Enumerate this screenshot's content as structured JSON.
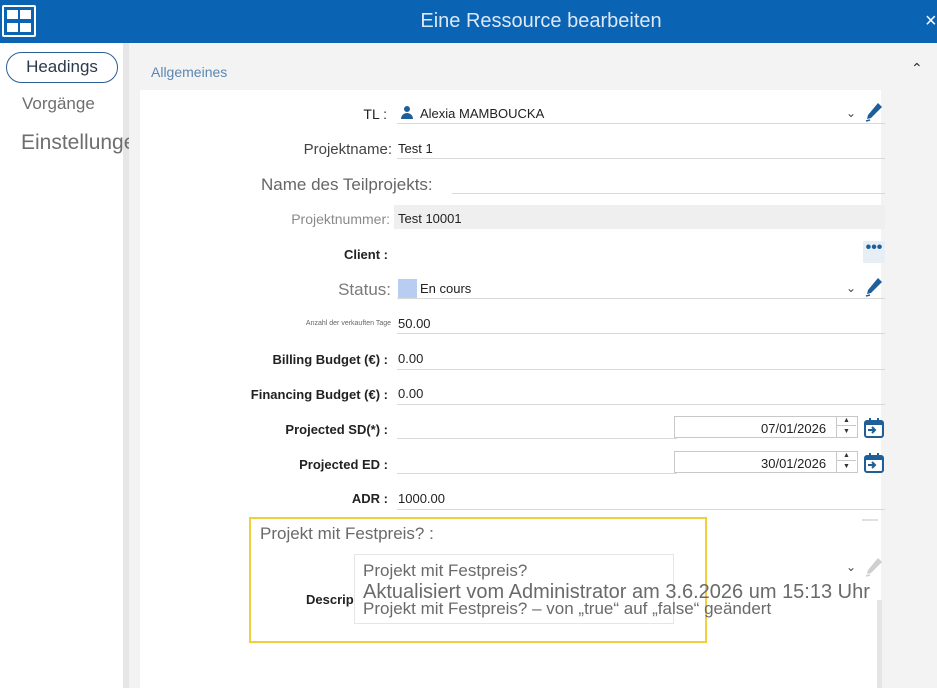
{
  "window": {
    "title": "Eine Ressource bearbeiten",
    "close_glyph": "×"
  },
  "nav": {
    "items": [
      {
        "label": "Headings",
        "active": true
      },
      {
        "label": "Vorgänge"
      },
      {
        "label": "Einstellungen"
      }
    ]
  },
  "section": {
    "title": "Allgemeines",
    "collapse_glyph": "⌃"
  },
  "form": {
    "tl": {
      "label": "TL :",
      "value": "Alexia MAMBOUCKA"
    },
    "projektname": {
      "label": "Projektname:",
      "value": "Test 1"
    },
    "teilprojekt": {
      "label": "Name des Teilprojekts:"
    },
    "projektnummer": {
      "label": "Projektnummer:",
      "value": "Test 10001"
    },
    "client": {
      "label": "Client :",
      "button": "•••"
    },
    "status": {
      "label": "Status:",
      "value": "En cours",
      "swatch_color": "#b9cdf3"
    },
    "verkaufte_tage": {
      "label": "Anzahl der verkauften Tage",
      "value": "50.00"
    },
    "billing_budget": {
      "label": "Billing Budget (€) :",
      "value": "0.00"
    },
    "financing_budget": {
      "label": "Financing Budget (€) :",
      "value": "0.00"
    },
    "projected_sd": {
      "label": "Projected SD(*) :",
      "value": "07/01/2026"
    },
    "projected_ed": {
      "label": "Projected ED :",
      "value": "30/01/2026"
    },
    "adr": {
      "label": "ADR :",
      "value": "1000.00"
    },
    "festpreis": {
      "label": "Projekt mit Festpreis? :"
    },
    "description": {
      "label": "Descrip"
    }
  },
  "tooltip": {
    "line1": "Projekt mit Festpreis?",
    "line2": "Aktualisiert vom Administrator am 3.6.2026 um 15:13 Uhr",
    "line3": "Projekt mit Festpreis? – von „true“ auf „false“ geändert"
  },
  "colors": {
    "titlebar": "#0b63b3",
    "accent": "#1f5f99",
    "highlight": "#f2cf3c"
  },
  "icons": {
    "app": "grid-icon",
    "person": "person-icon",
    "edit": "pencil-icon",
    "calendar": "calendar-icon"
  }
}
